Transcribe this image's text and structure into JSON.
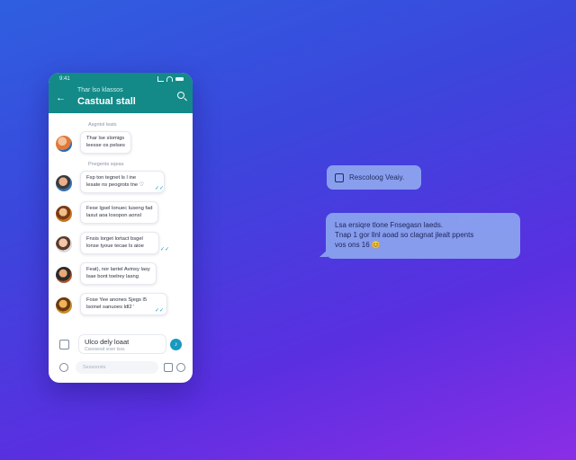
{
  "phone": {
    "status": {
      "time": "9:41"
    },
    "header": {
      "back_icon": "arrow-left-icon",
      "subtitle": "Thar lso klassos",
      "title": "Castual stall",
      "search_icon": "search-icon"
    },
    "sections": {
      "first": "Asgntol leats",
      "second": "Pnegents sqeas"
    },
    "messages": [
      {
        "avatar_color": "#e07a3a",
        "text_line1": "Thar lse slomigs",
        "text_line2": "leesse os pelses"
      },
      {
        "avatar_color": "#3a6fb0",
        "text_line1": "Fsp ton tegnet ls l ine",
        "text_line2": "lesate ns peogrots tne ♡",
        "ticks": "✓✓"
      },
      {
        "avatar_color": "#c9741c",
        "text_line1": "Fese lgsel lonuec luseng fad",
        "text_line2": "lasut aoa losopon aonsl"
      },
      {
        "avatar_color": "#d46b4a",
        "text_line1": "Fnsis lorget lortact bsgel",
        "text_line2": "lonse tyoue tecae ls aioe",
        "ticks": "✓✓"
      },
      {
        "avatar_color": "#b0562c",
        "text_line1": "Feat), nor lantel Avinsy lasy",
        "text_line2": "lsae bont toelrey lasng"
      },
      {
        "avatar_color": "#c98a2a",
        "text_line1": "Fose Yee anones Sjegs l5",
        "text_line2": "lsoinel sanuoes ldl2 '",
        "ticks": "✓✓"
      }
    ],
    "composer": {
      "typing_title": "Ulco dely loaat",
      "typing_sub": "Cseosesd sosn tsss",
      "send_icon": "send-icon",
      "attach_icon": "attach-icon"
    },
    "bottombar": {
      "placeholder": "Sessonsts",
      "camera_icon": "camera-icon",
      "sticker_icon": "sticker-icon",
      "emoji_icon": "emoji-icon"
    }
  },
  "notification": {
    "icon": "chat-icon",
    "label": "Rescoloog Veaiy."
  },
  "preview": {
    "line1": "Lsa ersiqre tlone Fnsegasn laeds.",
    "line2": "Tnap 1 gor llnl aoad so clagnat jlealt ppents",
    "line3": "vos ons 16 😊"
  }
}
